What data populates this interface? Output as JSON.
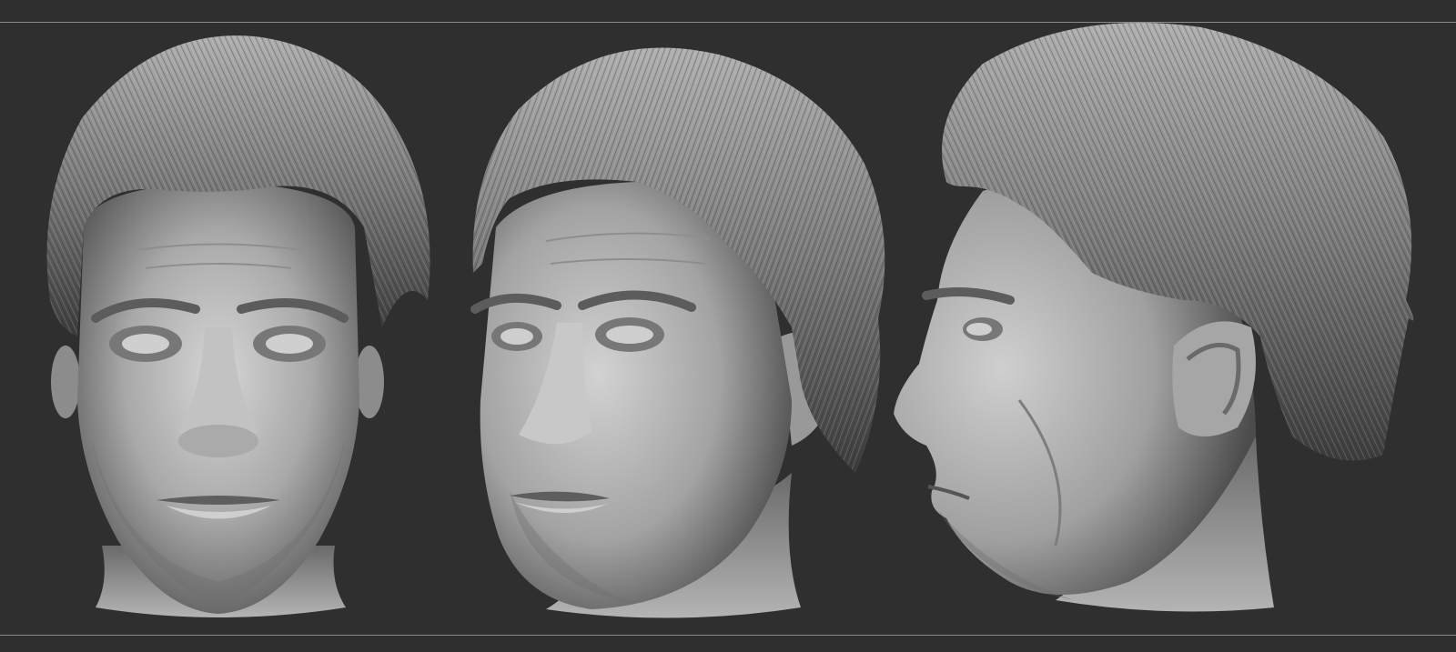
{
  "colors": {
    "background": "#2f2f2f",
    "separator": "#8a8a8a",
    "clay_light": "#d4d4d4",
    "clay_mid": "#9a9a9a",
    "clay_dark": "#3a3a3a"
  },
  "views": [
    {
      "name": "front",
      "icon": "front-view-head"
    },
    {
      "name": "three-quarter",
      "icon": "three-quarter-view-head"
    },
    {
      "name": "profile",
      "icon": "profile-view-head"
    }
  ]
}
